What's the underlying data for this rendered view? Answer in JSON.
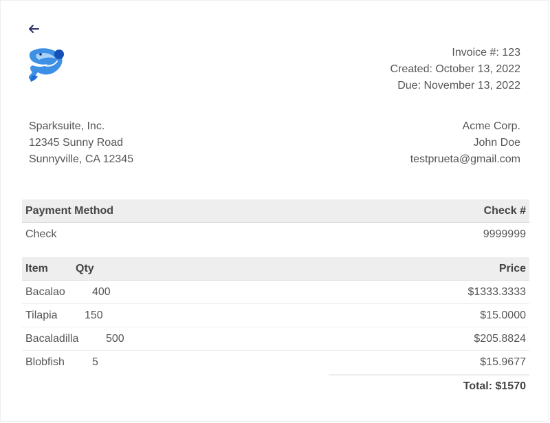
{
  "header": {
    "back_icon": "arrow-left-icon",
    "logo_icon": "fish-logo-icon",
    "invoice_number": "Invoice #: 123",
    "created": "Created: October 13, 2022",
    "due": "Due: November 13, 2022"
  },
  "from": {
    "company": "Sparksuite, Inc.",
    "street": "12345 Sunny Road",
    "city": "Sunnyville, CA 12345"
  },
  "to": {
    "company": "Acme Corp.",
    "name": "John Doe",
    "email": "testprueta@gmail.com"
  },
  "payment": {
    "method_header": "Payment Method",
    "check_header": "Check #",
    "method": "Check",
    "check_number": "9999999"
  },
  "items_table": {
    "item_header": "Item",
    "qty_header": "Qty",
    "price_header": "Price",
    "rows": [
      {
        "item": "Bacalao",
        "qty": "400",
        "price": "$1333.3333"
      },
      {
        "item": "Tilapia",
        "qty": "150",
        "price": "$15.0000"
      },
      {
        "item": "Bacaladilla",
        "qty": "500",
        "price": "$205.8824"
      },
      {
        "item": "Blobfish",
        "qty": "5",
        "price": "$15.9677"
      }
    ],
    "total": "Total: $1570"
  },
  "colors": {
    "text": "#555555",
    "heading_bg": "#eeeeee",
    "back_arrow": "#2b2f6b",
    "logo_blue": "#1e6fd9"
  }
}
